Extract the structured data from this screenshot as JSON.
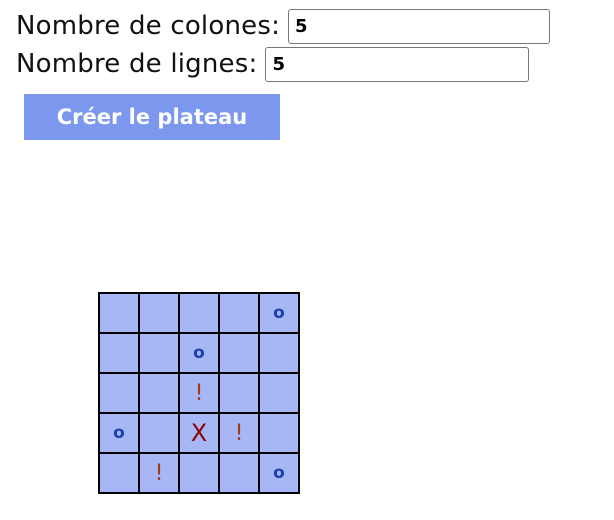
{
  "form": {
    "columns_label": "Nombre de colones:",
    "columns_value": "5",
    "rows_label": "Nombre de lignes:",
    "rows_value": "5"
  },
  "create_button_label": "Créer le plateau",
  "board": {
    "rows": [
      [
        "",
        "",
        "",
        "",
        "o"
      ],
      [
        "",
        "",
        "o",
        "",
        ""
      ],
      [
        "",
        "",
        "!",
        "",
        ""
      ],
      [
        "o",
        "",
        "X",
        "!",
        ""
      ],
      [
        "",
        "!",
        "",
        "",
        "o"
      ]
    ]
  },
  "colors": {
    "button": "#7b97ee",
    "cell": "#a7b7f6",
    "grid_line": "#000000",
    "mark_o": "#1e3fb0",
    "mark_x": "#8b0000",
    "mark_hint": "#a23a16"
  }
}
